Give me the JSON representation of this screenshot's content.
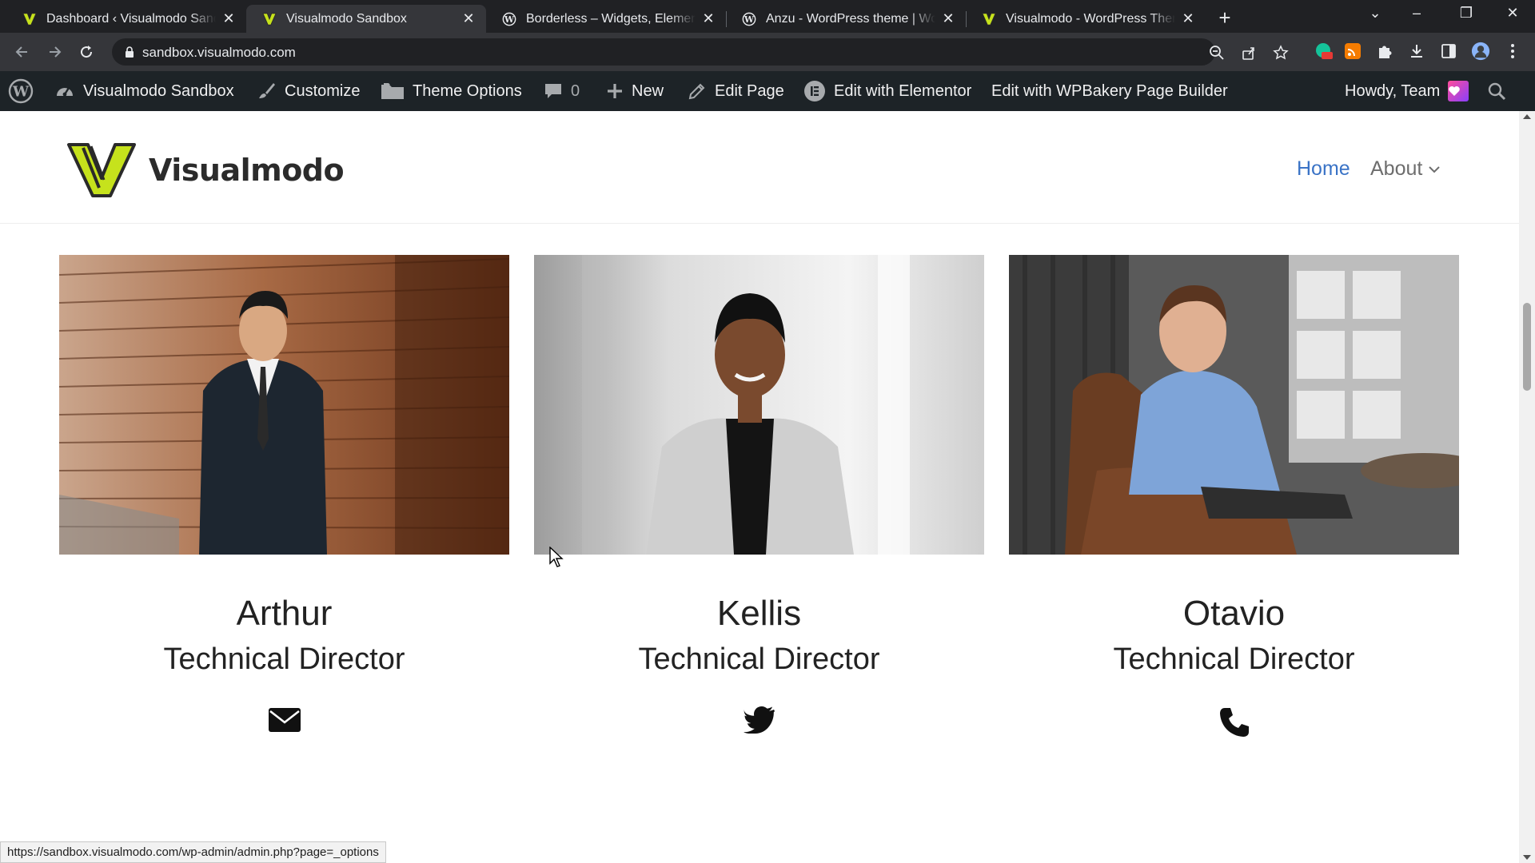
{
  "browser": {
    "tabs": [
      {
        "title": "Dashboard ‹ Visualmodo Sandbox",
        "favicon": "visualmodo-icon",
        "active": false
      },
      {
        "title": "Visualmodo Sandbox",
        "favicon": "visualmodo-icon",
        "active": true
      },
      {
        "title": "Borderless – Widgets, Elements, Templates",
        "favicon": "wordpress-icon",
        "active": false
      },
      {
        "title": "Anzu - WordPress theme | WordPress",
        "favicon": "wordpress-icon",
        "active": false
      },
      {
        "title": "Visualmodo - WordPress Themes",
        "favicon": "visualmodo-icon",
        "active": false
      }
    ],
    "url": "sandbox.visualmodo.com",
    "status_url": "https://sandbox.visualmodo.com/wp-admin/admin.php?page=_options"
  },
  "adminbar": {
    "site_name": "Visualmodo Sandbox",
    "customize": "Customize",
    "theme_options": "Theme Options",
    "comments_count": "0",
    "new": "New",
    "edit_page": "Edit Page",
    "edit_elementor": "Edit with Elementor",
    "edit_wpbakery": "Edit with WPBakery Page Builder",
    "howdy": "Howdy, Team"
  },
  "site": {
    "logo_text": "Visualmodo",
    "nav": {
      "home": "Home",
      "about": "About"
    },
    "accent_color": "#3a73c6",
    "logo_color": "#c6e21c"
  },
  "team": [
    {
      "name": "Arthur",
      "role": "Technical Director",
      "icon": "envelope-icon"
    },
    {
      "name": "Kellis",
      "role": "Technical Director",
      "icon": "twitter-icon"
    },
    {
      "name": "Otavio",
      "role": "Technical Director",
      "icon": "phone-icon"
    }
  ]
}
